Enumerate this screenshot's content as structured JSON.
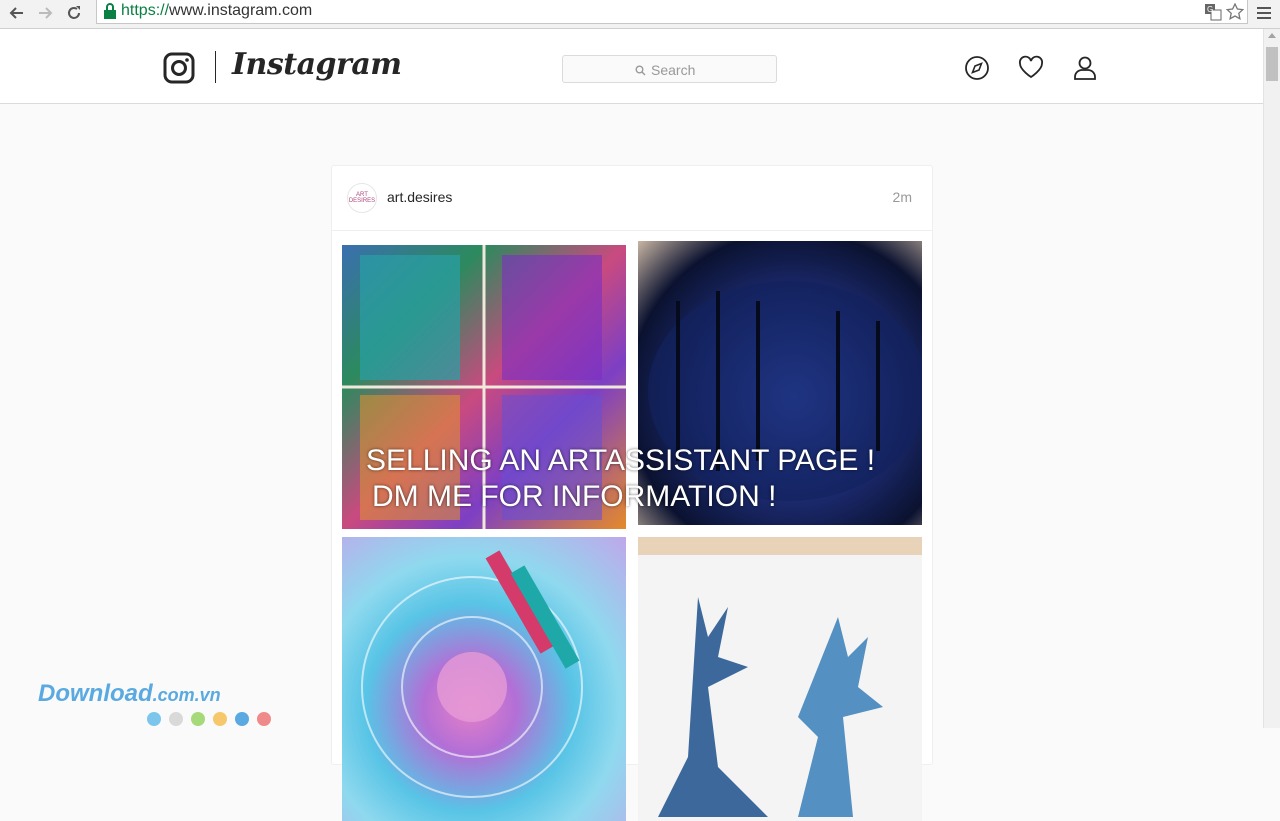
{
  "browser": {
    "url_scheme": "https://",
    "url_rest": "www.instagram.com"
  },
  "header": {
    "logo_text": "Instagram",
    "search_placeholder": "Search"
  },
  "post": {
    "username": "art.desires",
    "time": "2m",
    "avatar_text": "ART DESIRES",
    "overlay_line1": "SELLING AN ARTASSISTANT PAGE !",
    "overlay_line2": "DM ME FOR INFORMATION !"
  },
  "watermark": {
    "brand": "Download",
    "suffix": ".com.vn",
    "dot_colors": [
      "#7cc6ee",
      "#d9d9d9",
      "#a6d97a",
      "#f6c86b",
      "#5aa9e0",
      "#f08a8a"
    ]
  },
  "colors": {
    "text": "#262626",
    "border": "#dbdbdb",
    "url_green": "#0b8043"
  }
}
